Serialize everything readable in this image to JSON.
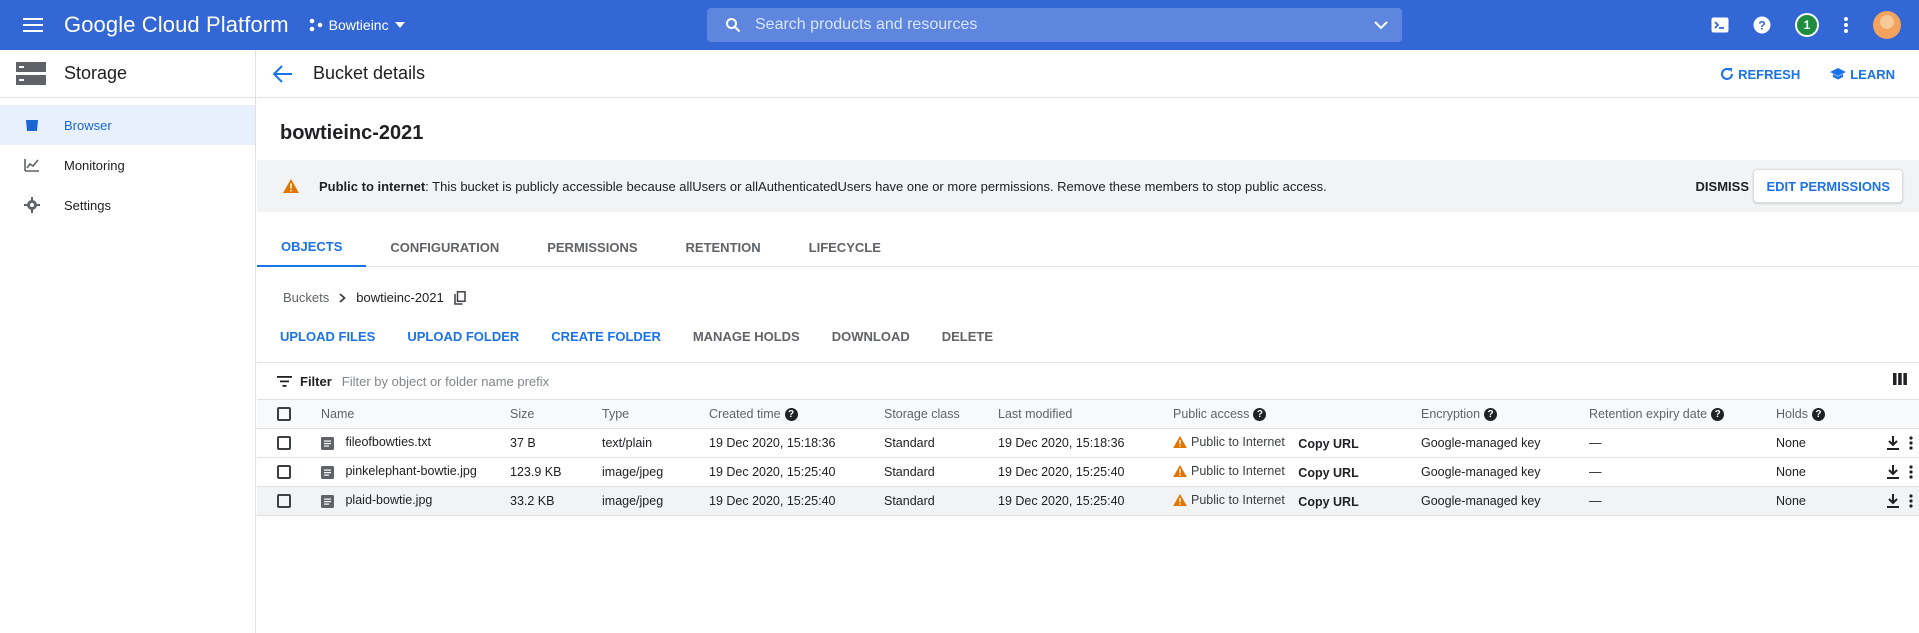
{
  "topbar": {
    "brand": "Google Cloud Platform",
    "project": "Bowtieinc",
    "search_placeholder": "Search products and resources",
    "notification_count": "1"
  },
  "sidebar": {
    "title": "Storage",
    "items": [
      {
        "label": "Browser",
        "icon": "bucket-icon",
        "active": true
      },
      {
        "label": "Monitoring",
        "icon": "chart-icon",
        "active": false
      },
      {
        "label": "Settings",
        "icon": "gear-icon",
        "active": false
      }
    ]
  },
  "header": {
    "title": "Bucket details",
    "refresh_label": "REFRESH",
    "learn_label": "LEARN"
  },
  "bucket": {
    "name": "bowtieinc-2021"
  },
  "banner": {
    "bold_text": "Public to internet",
    "text": ": This bucket is publicly accessible because allUsers or allAuthenticatedUsers have one or more permissions. Remove these members to stop public access.",
    "dismiss_label": "DISMISS",
    "edit_permissions_label": "EDIT PERMISSIONS"
  },
  "tabs": [
    {
      "label": "OBJECTS",
      "active": true
    },
    {
      "label": "CONFIGURATION",
      "active": false
    },
    {
      "label": "PERMISSIONS",
      "active": false
    },
    {
      "label": "RETENTION",
      "active": false
    },
    {
      "label": "LIFECYCLE",
      "active": false
    }
  ],
  "breadcrumb": {
    "root": "Buckets",
    "current": "bowtieinc-2021"
  },
  "toolbar": {
    "upload_files": "UPLOAD FILES",
    "upload_folder": "UPLOAD FOLDER",
    "create_folder": "CREATE FOLDER",
    "manage_holds": "MANAGE HOLDS",
    "download": "DOWNLOAD",
    "delete": "DELETE"
  },
  "filter": {
    "label": "Filter",
    "placeholder": "Filter by object or folder name prefix"
  },
  "table": {
    "headers": {
      "name": "Name",
      "size": "Size",
      "type": "Type",
      "created": "Created time",
      "storage_class": "Storage class",
      "last_modified": "Last modified",
      "public_access": "Public access",
      "encryption": "Encryption",
      "retention": "Retention expiry date",
      "holds": "Holds"
    },
    "rows": [
      {
        "name": "fileofbowties.txt",
        "size": "37 B",
        "type": "text/plain",
        "created": "19 Dec 2020, 15:18:36",
        "storage_class": "Standard",
        "last_modified": "19 Dec 2020, 15:18:36",
        "public_access": "Public to Internet",
        "copy_url": "Copy URL",
        "encryption": "Google-managed key",
        "retention": "—",
        "holds": "None"
      },
      {
        "name": "pinkelephant-bowtie.jpg",
        "size": "123.9 KB",
        "type": "image/jpeg",
        "created": "19 Dec 2020, 15:25:40",
        "storage_class": "Standard",
        "last_modified": "19 Dec 2020, 15:25:40",
        "public_access": "Public to Internet",
        "copy_url": "Copy URL",
        "encryption": "Google-managed key",
        "retention": "—",
        "holds": "None"
      },
      {
        "name": "plaid-bowtie.jpg",
        "size": "33.2 KB",
        "type": "image/jpeg",
        "created": "19 Dec 2020, 15:25:40",
        "storage_class": "Standard",
        "last_modified": "19 Dec 2020, 15:25:40",
        "public_access": "Public to Internet",
        "copy_url": "Copy URL",
        "encryption": "Google-managed key",
        "retention": "—",
        "holds": "None"
      }
    ]
  },
  "colors": {
    "topbar": "#3367d6",
    "accent": "#1a73e8",
    "warning": "#e37400",
    "active_bg": "#e8f0fe"
  }
}
